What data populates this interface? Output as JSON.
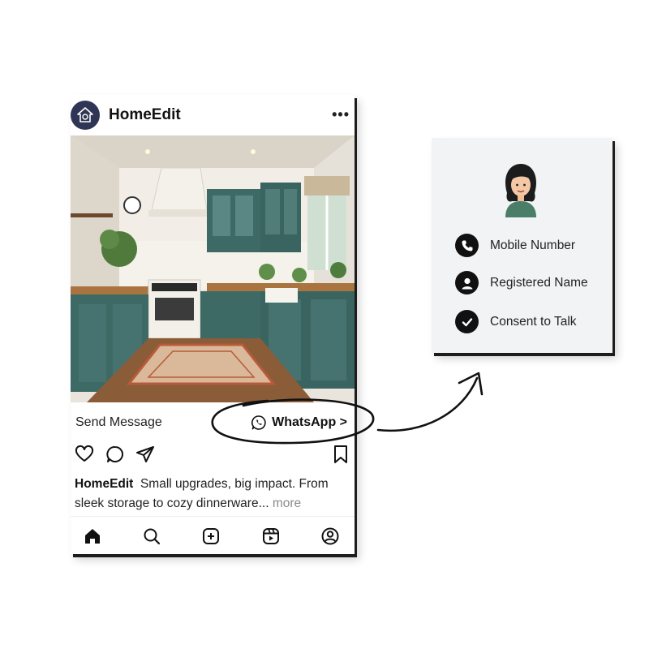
{
  "post": {
    "username": "HomeEdit",
    "more_icon": "more-horizontal-icon",
    "send_message": "Send Message",
    "whatsapp_label": "WhatsApp >",
    "caption_user": "HomeEdit",
    "caption_text": "Small upgrades, big impact. From sleek storage to cozy dinnerware...",
    "caption_more": "more",
    "actions": [
      "heart-icon",
      "comment-icon",
      "share-icon",
      "bookmark-icon"
    ],
    "tabs": [
      "home-icon",
      "search-icon",
      "add-post-icon",
      "reels-icon",
      "profile-icon"
    ]
  },
  "card": {
    "items": [
      {
        "label": "Mobile Number",
        "icon": "phone-icon"
      },
      {
        "label": "Registered Name",
        "icon": "user-icon"
      },
      {
        "label": "Consent to Talk",
        "icon": "check-icon"
      }
    ]
  },
  "colors": {
    "cabinet_teal": "#3e6a66",
    "avatar_navy": "#2f3554",
    "card_bg": "#f2f3f5"
  }
}
